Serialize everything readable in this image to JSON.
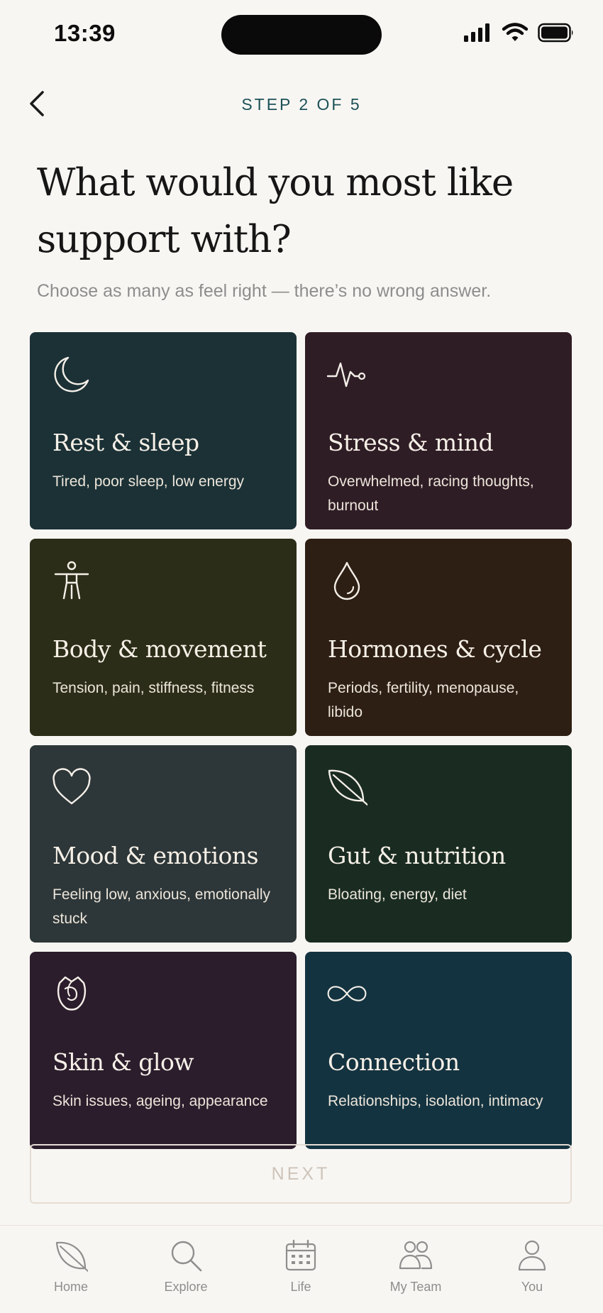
{
  "status_bar": {
    "time": "13:39"
  },
  "header": {
    "step": "STEP 2 OF 5",
    "title": "What would you most like support with?",
    "subtitle": "Choose as many as feel right — there’s no wrong answer."
  },
  "cards": [
    {
      "title": "Rest & sleep",
      "description": "Tired, poor sleep, low energy",
      "icon": "moon-icon",
      "color": "#1b3136"
    },
    {
      "title": "Stress & mind",
      "description": "Overwhelmed, racing thoughts, burnout",
      "icon": "heartbeat-icon",
      "color": "#2f1d26"
    },
    {
      "title": "Body & movement",
      "description": "Tension, pain, stiffness, fitness",
      "icon": "person-icon",
      "color": "#2c2d18"
    },
    {
      "title": "Hormones & cycle",
      "description": "Periods, fertility, menopause, libido",
      "icon": "droplet-icon",
      "color": "#2e1f14"
    },
    {
      "title": "Mood & emotions",
      "description": "Feeling low, anxious, emotionally stuck",
      "icon": "heart-icon",
      "color": "#2d3638"
    },
    {
      "title": "Gut & nutrition",
      "description": "Bloating, energy, diet",
      "icon": "leaf-icon",
      "color": "#1a2c22"
    },
    {
      "title": "Skin & glow",
      "description": "Skin issues, ageing, appearance",
      "icon": "rose-icon",
      "color": "#2b1d2c"
    },
    {
      "title": "Connection",
      "description": "Relationships, isolation, intimacy",
      "icon": "infinity-icon",
      "color": "#143340"
    }
  ],
  "next_button": {
    "label": "NEXT"
  },
  "tab_bar": {
    "items": [
      {
        "label": "Home",
        "icon": "leaf-icon"
      },
      {
        "label": "Explore",
        "icon": "search-icon"
      },
      {
        "label": "Life",
        "icon": "calendar-icon"
      },
      {
        "label": "My Team",
        "icon": "team-icon"
      },
      {
        "label": "You",
        "icon": "user-icon"
      }
    ]
  },
  "colors": {
    "background": "#f8f6f3",
    "accent": "#1c5157",
    "card_text": "#f6f0e7",
    "tab_icon": "#8e8e8e"
  }
}
